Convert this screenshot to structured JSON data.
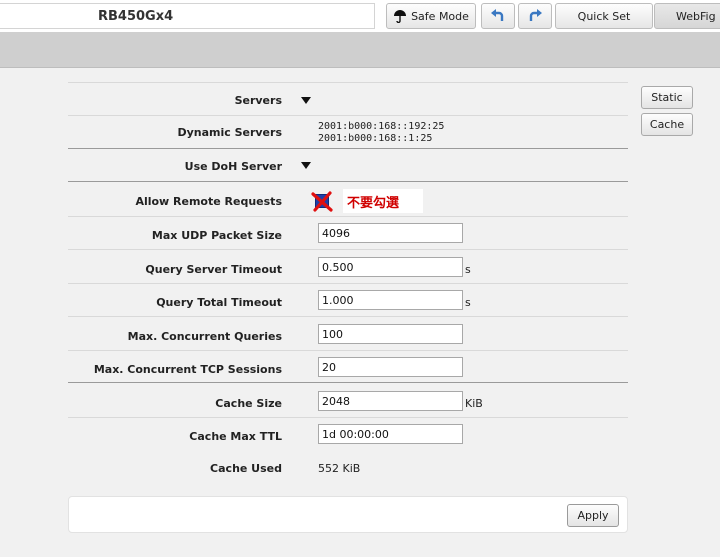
{
  "header": {
    "device_name": "RB450Gx4",
    "safe_mode_label": "Safe Mode",
    "quick_set_label": "Quick Set",
    "webfig_label": "WebFig"
  },
  "side_buttons": {
    "static_label": "Static",
    "cache_label": "Cache"
  },
  "form": {
    "servers": {
      "label": "Servers"
    },
    "dynamic_servers": {
      "label": "Dynamic Servers",
      "values": [
        "2001:b000:168::192:25",
        "2001:b000:168::1:25"
      ]
    },
    "use_doh_server": {
      "label": "Use DoH Server"
    },
    "allow_remote_requests": {
      "label": "Allow Remote Requests",
      "checked": true,
      "annotation": "不要勾選",
      "annotation_color": "#d00000"
    },
    "max_udp_packet_size": {
      "label": "Max UDP Packet Size",
      "value": "4096"
    },
    "query_server_timeout": {
      "label": "Query Server Timeout",
      "value": "0.500",
      "unit": "s"
    },
    "query_total_timeout": {
      "label": "Query Total Timeout",
      "value": "1.000",
      "unit": "s"
    },
    "max_concurrent_queries": {
      "label": "Max. Concurrent Queries",
      "value": "100"
    },
    "max_concurrent_tcp_sessions": {
      "label": "Max. Concurrent TCP Sessions",
      "value": "20"
    },
    "cache_size": {
      "label": "Cache Size",
      "value": "2048",
      "unit": "KiB"
    },
    "cache_max_ttl": {
      "label": "Cache Max TTL",
      "value": "1d 00:00:00"
    },
    "cache_used": {
      "label": "Cache Used",
      "value": "552 KiB"
    }
  },
  "footer": {
    "apply_label": "Apply"
  },
  "colors": {
    "checkbox": "#1f3fa8",
    "annotation": "#d00000",
    "grey_bar": "#cfcfcf"
  }
}
